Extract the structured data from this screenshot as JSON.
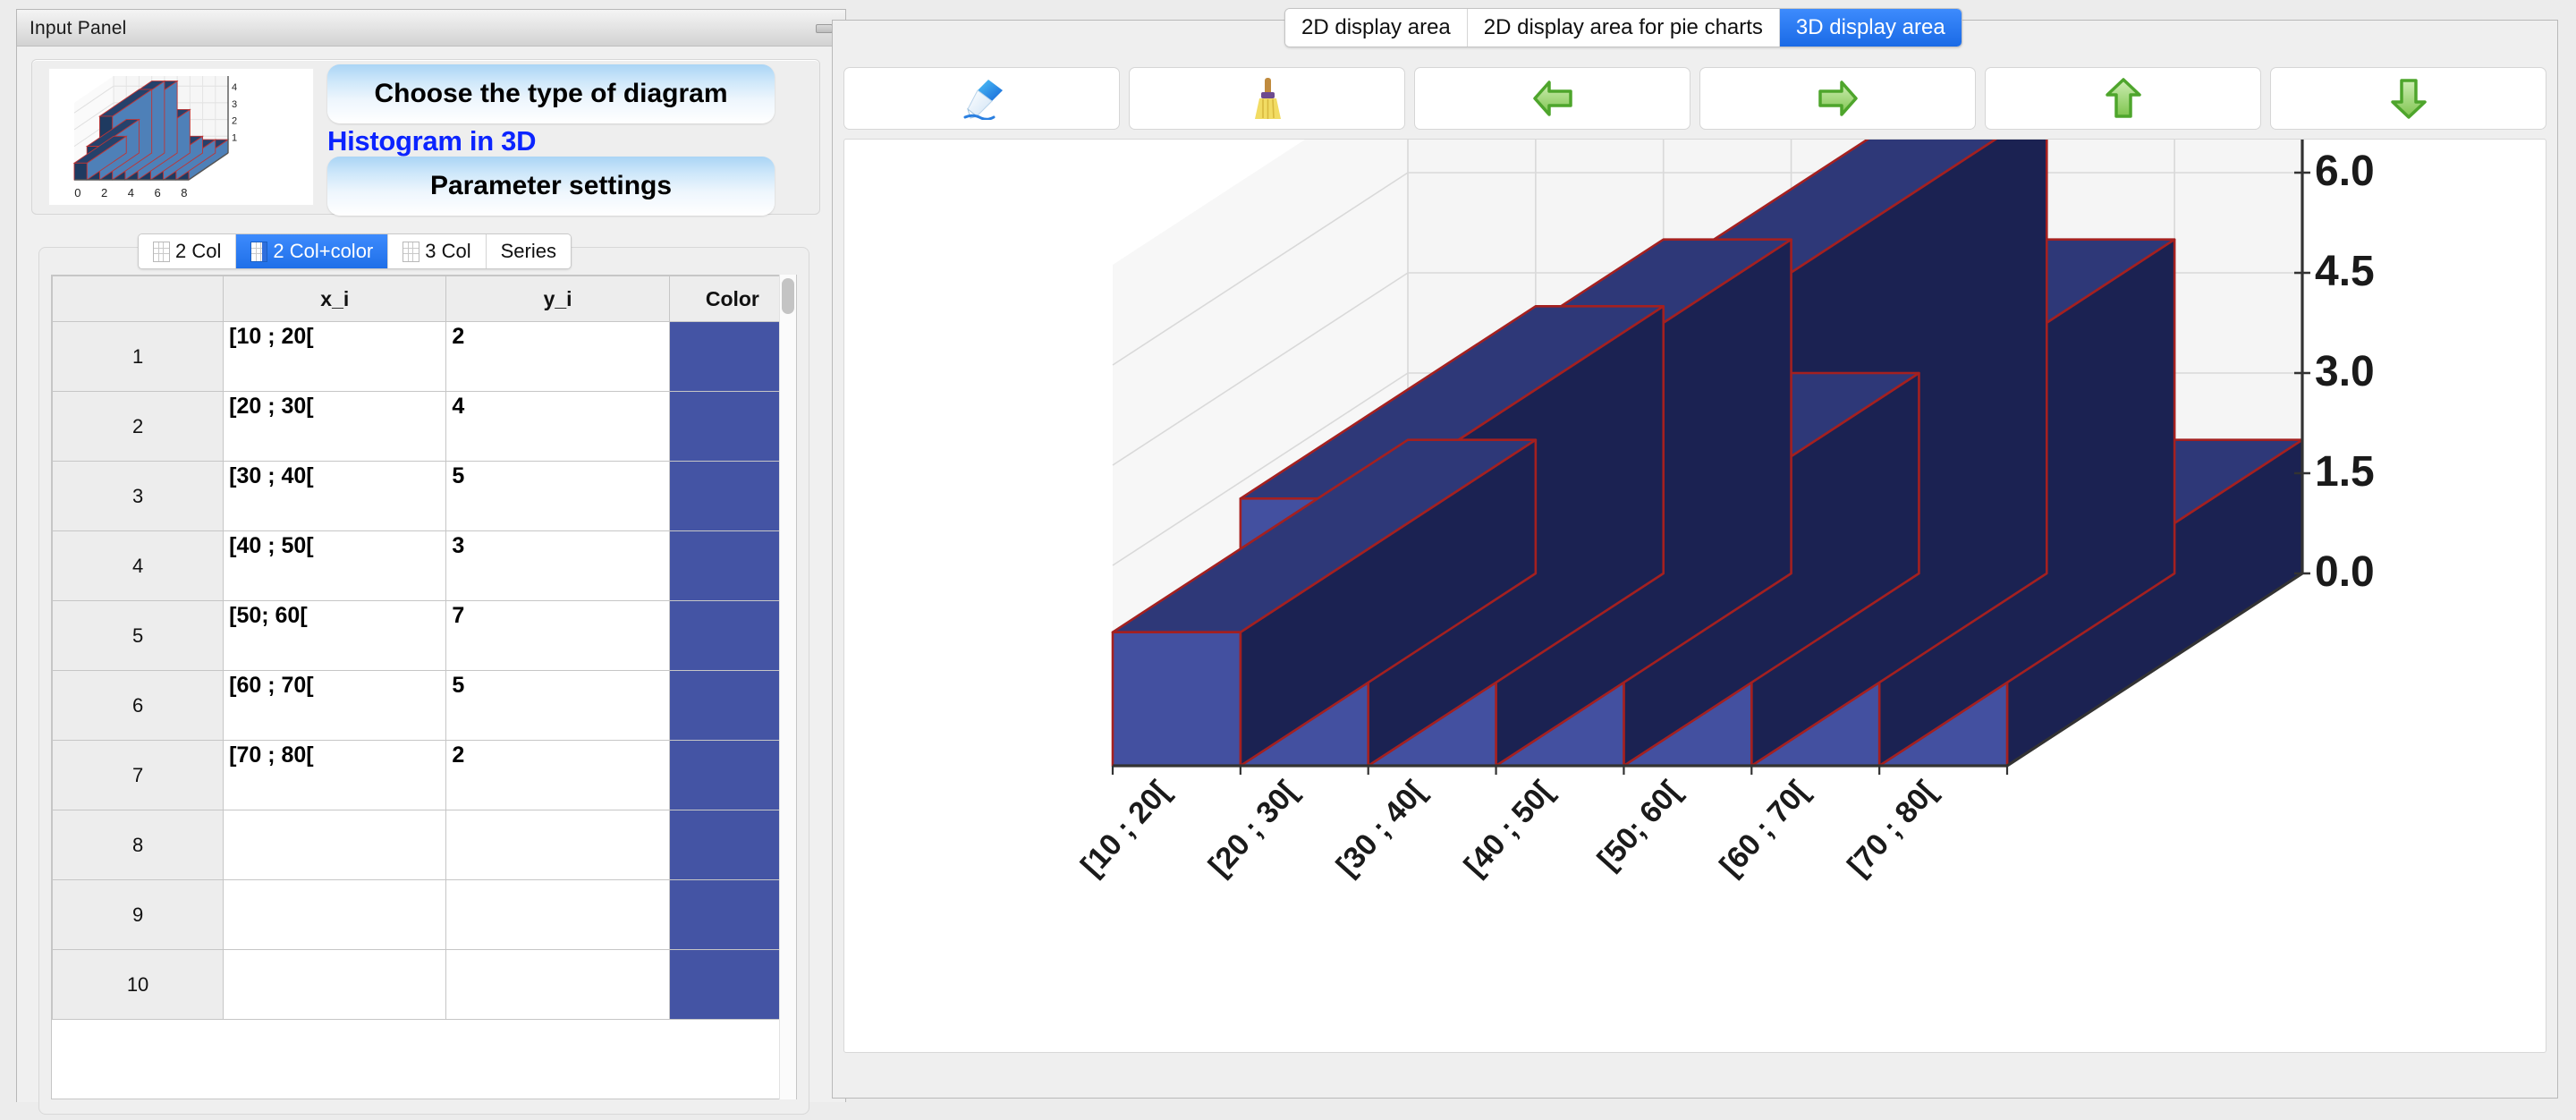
{
  "input_panel": {
    "title": "Input Panel",
    "minimize_label": "",
    "chooser": {
      "type_button": "Choose the type of diagram",
      "current_type": "Histogram in 3D",
      "settings_button": "Parameter settings"
    },
    "thumbnail": {
      "x_ticks": [
        "0",
        "2",
        "4",
        "6",
        "8"
      ],
      "z_ticks": [
        "1",
        "2",
        "3",
        "4"
      ],
      "values": [
        1,
        2,
        3.8,
        4.3,
        4.3,
        2.6,
        1,
        0.8,
        0.8
      ]
    },
    "mode_tabs": [
      {
        "label": "2 Col",
        "active": false
      },
      {
        "label": "2 Col+color",
        "active": true
      },
      {
        "label": "3 Col",
        "active": false
      },
      {
        "label": "Series",
        "active": false
      }
    ],
    "table": {
      "headers": [
        "",
        "x_i",
        "y_i",
        "Color"
      ],
      "rows": [
        {
          "n": "1",
          "x": "[10 ; 20[",
          "y": "2",
          "color": "#4454a4"
        },
        {
          "n": "2",
          "x": "[20 ; 30[",
          "y": "4",
          "color": "#4454a4"
        },
        {
          "n": "3",
          "x": "[30 ; 40[",
          "y": "5",
          "color": "#4454a4"
        },
        {
          "n": "4",
          "x": "[40 ; 50[",
          "y": "3",
          "color": "#4454a4"
        },
        {
          "n": "5",
          "x": "[50; 60[",
          "y": "7",
          "color": "#4454a4"
        },
        {
          "n": "6",
          "x": "[60 ; 70[",
          "y": "5",
          "color": "#4454a4"
        },
        {
          "n": "7",
          "x": "[70 ; 80[",
          "y": "2",
          "color": "#4454a4"
        },
        {
          "n": "8",
          "x": "",
          "y": "",
          "color": "#4454a4"
        },
        {
          "n": "9",
          "x": "",
          "y": "",
          "color": "#4454a4"
        },
        {
          "n": "10",
          "x": "",
          "y": "",
          "color": "#4454a4"
        }
      ]
    }
  },
  "display_panel": {
    "tabs": [
      {
        "label": "2D display area",
        "active": false
      },
      {
        "label": "2D display area for pie charts",
        "active": false
      },
      {
        "label": "3D display area",
        "active": true
      }
    ],
    "toolbar": [
      {
        "name": "draw-pen-icon",
        "label": ""
      },
      {
        "name": "broom-clear-icon",
        "label": ""
      },
      {
        "name": "arrow-left-icon",
        "label": ""
      },
      {
        "name": "arrow-right-icon",
        "label": ""
      },
      {
        "name": "arrow-up-icon",
        "label": ""
      },
      {
        "name": "arrow-down-icon",
        "label": ""
      }
    ]
  },
  "colors": {
    "bar_front": "#4350a0",
    "bar_top": "#2e3878",
    "bar_side": "#1b2252",
    "bar_edge": "#a42020",
    "accent_blue": "#1a6ae6",
    "title_blue": "#0b24ff",
    "panel_bg": "#efefef"
  },
  "chart_data": {
    "type": "bar",
    "title": "",
    "xlabel": "",
    "ylabel": "",
    "categories": [
      "[10 ; 20[",
      "[20 ; 30[",
      "[30 ; 40[",
      "[40 ; 50[",
      "[50; 60[",
      "[60 ; 70[",
      "[70 ; 80["
    ],
    "values": [
      2,
      4,
      5,
      3,
      7,
      5,
      2
    ],
    "z_ticks": [
      "0.0",
      "1.5",
      "3.0",
      "4.5",
      "6.0"
    ],
    "z_tick_values": [
      0.0,
      1.5,
      3.0,
      4.5,
      6.0
    ],
    "zlim": [
      0,
      7.5
    ],
    "grid": true,
    "legend": "none",
    "projection": "3d"
  }
}
